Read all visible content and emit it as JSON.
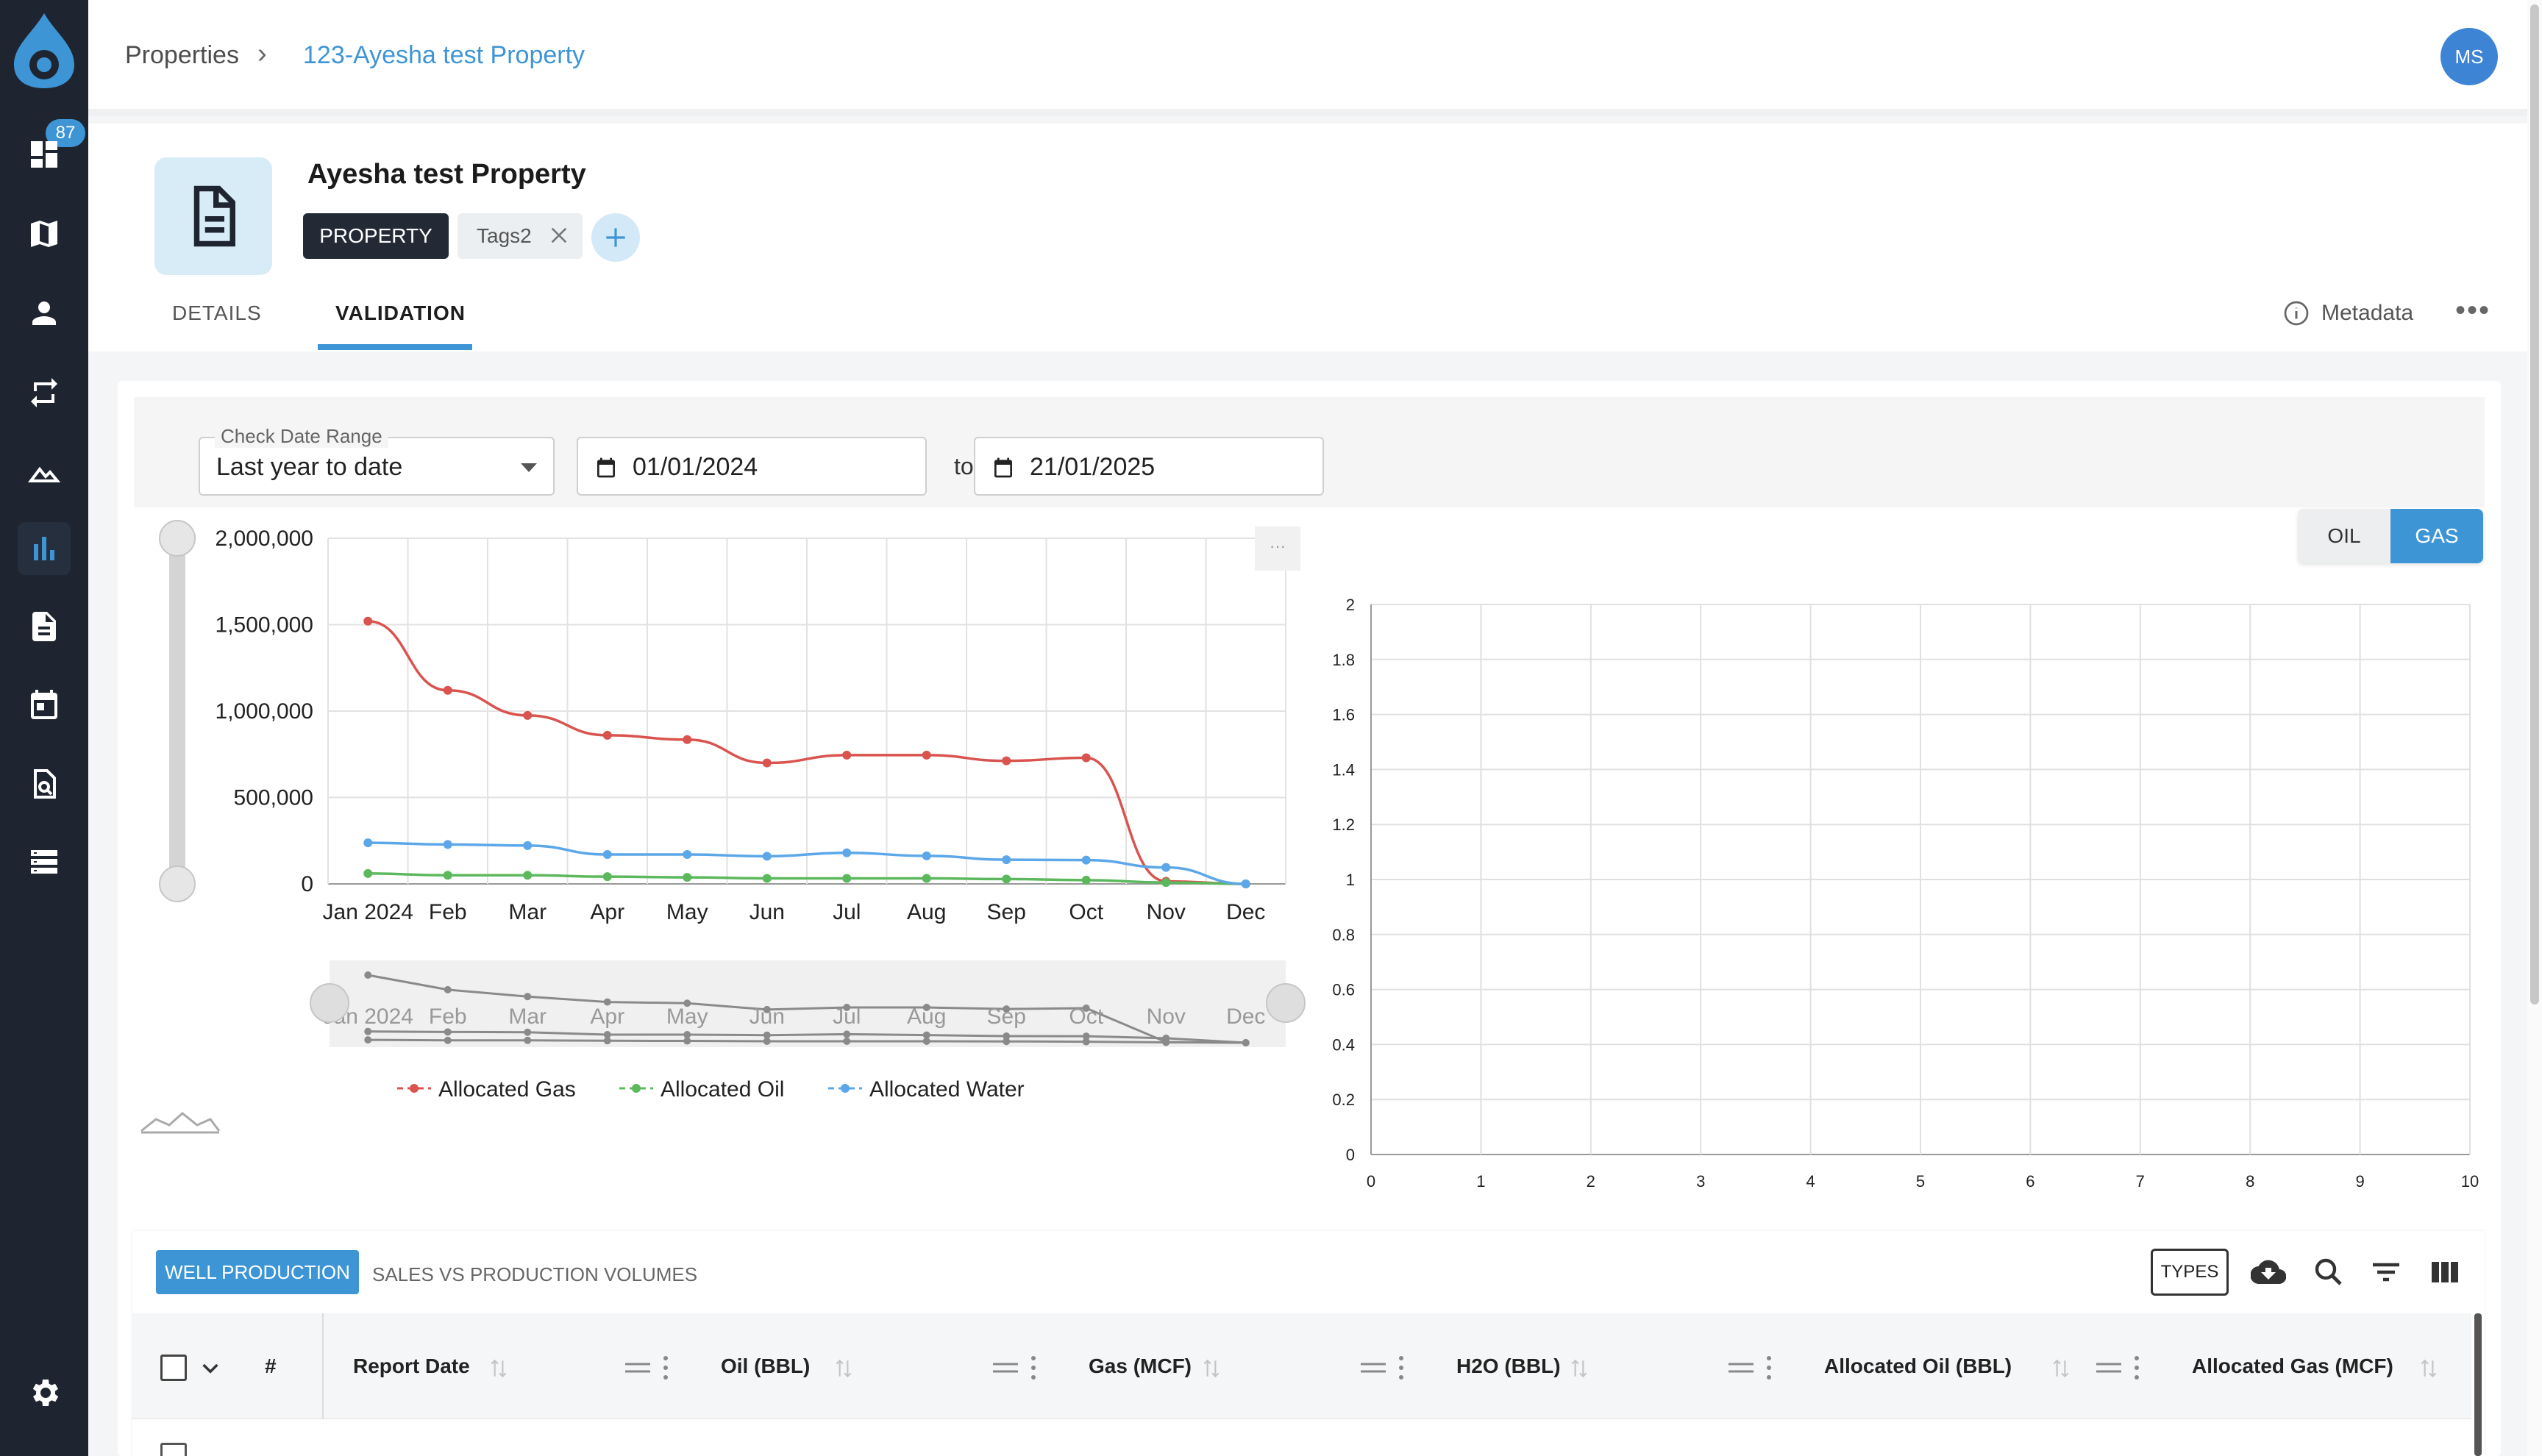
{
  "sidebar": {
    "badge_count": "87",
    "items": [
      {
        "name": "dashboard-icon"
      },
      {
        "name": "map-icon"
      },
      {
        "name": "person-icon"
      },
      {
        "name": "transfer-icon"
      },
      {
        "name": "terrain-icon"
      },
      {
        "name": "bar-chart-icon"
      },
      {
        "name": "document-icon"
      },
      {
        "name": "calendar-icon"
      },
      {
        "name": "doc-search-icon"
      },
      {
        "name": "list-icon"
      },
      {
        "name": "gear-icon"
      }
    ]
  },
  "breadcrumb": {
    "root": "Properties",
    "separator": "›",
    "current": "123-Ayesha test Property"
  },
  "user": {
    "initials": "MS"
  },
  "property": {
    "title": "Ayesha test Property",
    "type_chip": "PROPERTY",
    "tags": [
      "Tags2"
    ]
  },
  "tabs": [
    {
      "label": "DETAILS"
    },
    {
      "label": "VALIDATION"
    }
  ],
  "metadata_label": "Metadata",
  "filters": {
    "range_legend": "Check Date Range",
    "range_value": "Last year to date",
    "start_date": "01/01/2024",
    "to_label": "to",
    "end_date": "21/01/2025"
  },
  "toggle": {
    "oil": "OIL",
    "gas": "GAS",
    "selected": "GAS"
  },
  "colors": {
    "accent": "#3d95d6",
    "sidebar": "#1e2530",
    "gas": "#d9534f",
    "oil": "#5cb85c",
    "water": "#5ba7e8"
  },
  "chart_data": [
    {
      "type": "line",
      "categories": [
        "Jan 2024",
        "Feb",
        "Mar",
        "Apr",
        "May",
        "Jun",
        "Jul",
        "Aug",
        "Sep",
        "Oct",
        "Nov",
        "Dec"
      ],
      "series": [
        {
          "name": "Allocated Gas",
          "color": "#d9534f",
          "values": [
            1520000,
            1120000,
            975000,
            860000,
            835000,
            700000,
            745000,
            745000,
            712000,
            730000,
            15000,
            0
          ]
        },
        {
          "name": "Allocated Oil",
          "color": "#5cb85c",
          "values": [
            60000,
            50000,
            50000,
            42000,
            38000,
            32000,
            32000,
            32000,
            28000,
            22000,
            8000,
            0
          ]
        },
        {
          "name": "Allocated Water",
          "color": "#5ba7e8",
          "values": [
            238000,
            228000,
            222000,
            170000,
            170000,
            160000,
            180000,
            162000,
            140000,
            138000,
            95000,
            0
          ]
        }
      ],
      "yticks": [
        "2,000,000",
        "1,500,000",
        "1,000,000",
        "500,000",
        "0"
      ],
      "ylim": [
        0,
        2000000
      ],
      "grid": true,
      "legend": "bottom",
      "has_range_slider": true
    },
    {
      "type": "line",
      "series": [],
      "xticks": [
        "0",
        "1",
        "2",
        "3",
        "4",
        "5",
        "6",
        "7",
        "8",
        "9",
        "10"
      ],
      "yticks": [
        "2",
        "1.8",
        "1.6",
        "1.4",
        "1.2",
        "1",
        "0.8",
        "0.6",
        "0.4",
        "0.2",
        "0"
      ],
      "xlim": [
        0,
        10
      ],
      "ylim": [
        0,
        2
      ],
      "grid": true
    }
  ],
  "grid": {
    "tabs": [
      "WELL PRODUCTION",
      "SALES VS PRODUCTION VOLUMES"
    ],
    "types_label": "TYPES",
    "columns": [
      {
        "label": "#"
      },
      {
        "label": "Report Date"
      },
      {
        "label": "Oil (BBL)"
      },
      {
        "label": "Gas (MCF)"
      },
      {
        "label": "H2O (BBL)"
      },
      {
        "label": "Allocated Oil (BBL)"
      },
      {
        "label": "Allocated Gas (MCF)"
      }
    ]
  }
}
